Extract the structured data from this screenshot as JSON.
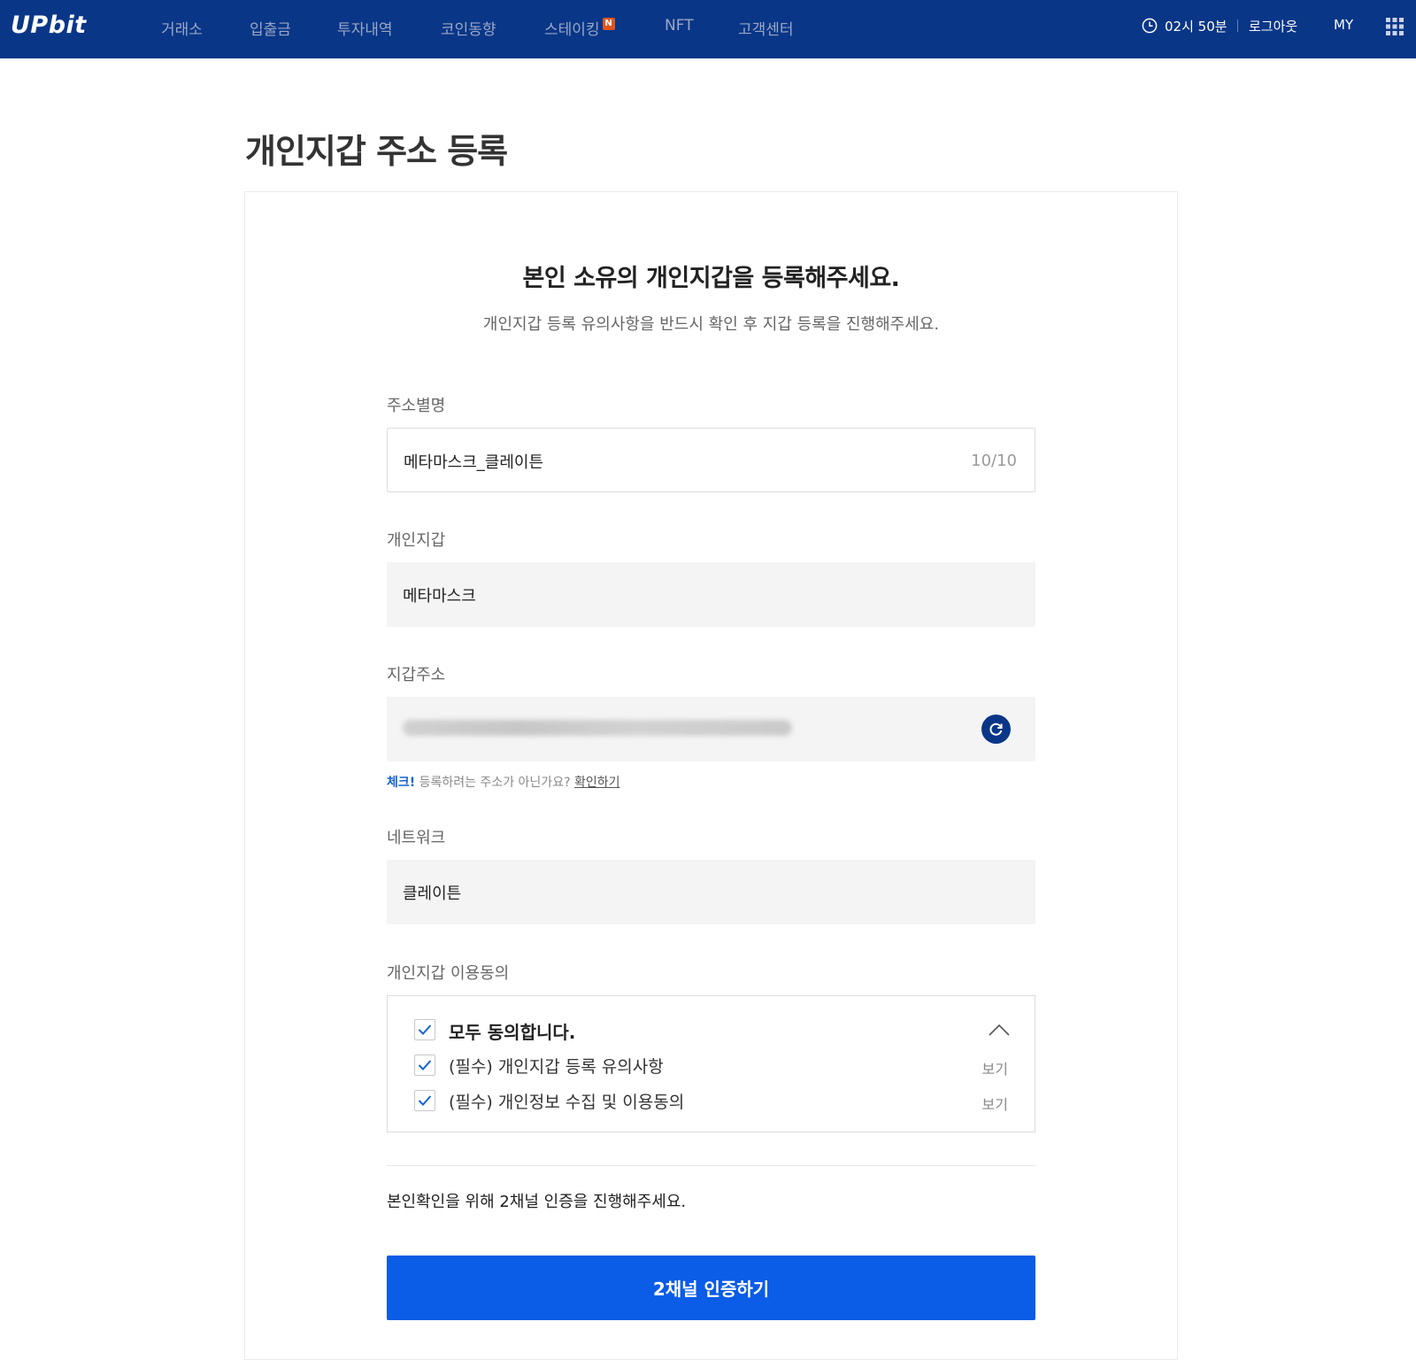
{
  "header": {
    "logo": "UPbit",
    "nav": [
      {
        "label": "거래소"
      },
      {
        "label": "입출금"
      },
      {
        "label": "투자내역"
      },
      {
        "label": "코인동향"
      },
      {
        "label": "스테이킹",
        "badge": "N"
      },
      {
        "label": "NFT"
      },
      {
        "label": "고객센터"
      }
    ],
    "session_time": "02시 50분",
    "logout": "로그아웃",
    "my": "MY",
    "colors": {
      "bar": "#093687",
      "badge": "#e0551f"
    }
  },
  "page": {
    "title": "개인지갑 주소 등록",
    "heading": "본인 소유의 개인지갑을 등록해주세요.",
    "subheading": "개인지갑 등록 유의사항을 반드시 확인 후 지갑 등록을 진행해주세요."
  },
  "form": {
    "alias": {
      "label": "주소별명",
      "value": "메타마스크_클레이튼",
      "counter": "10/10"
    },
    "wallet": {
      "label": "개인지갑",
      "value": "메타마스크"
    },
    "address": {
      "label": "지갑주소",
      "value_state": "blurred",
      "refresh_icon": "refresh-icon"
    },
    "check_note": {
      "bold": "체크!",
      "text": "등록하려는 주소가 아닌가요?",
      "link": "확인하기"
    },
    "network": {
      "label": "네트워크",
      "value": "클레이튼"
    },
    "consent": {
      "label": "개인지갑 이용동의",
      "all": {
        "text": "모두 동의합니다.",
        "checked": true
      },
      "items": [
        {
          "text": "(필수) 개인지갑 등록 유의사항",
          "view": "보기",
          "checked": true
        },
        {
          "text": "(필수) 개인정보 수집 및 이용동의",
          "view": "보기",
          "checked": true
        }
      ]
    },
    "auth_note": "본인확인을 위해 2채널 인증을 진행해주세요.",
    "submit": "2채널 인증하기",
    "colors": {
      "primary": "#0b5ce6",
      "link": "#1563d6"
    }
  }
}
